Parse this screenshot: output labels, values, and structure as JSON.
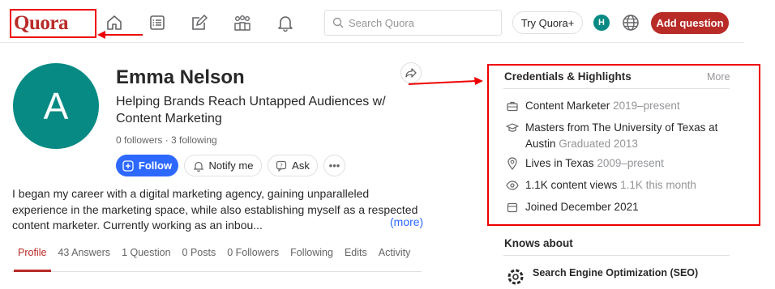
{
  "header": {
    "logo": "Quora",
    "nav_icons": [
      "home-icon",
      "answer-list-icon",
      "write-icon",
      "spaces-icon",
      "notifications-icon"
    ],
    "search_placeholder": "Search Quora",
    "try_label": "Try Quora+",
    "user_initial": "H",
    "add_question_label": "Add question"
  },
  "profile": {
    "initial": "A",
    "name": "Emma Nelson",
    "tagline": "Helping Brands Reach Untapped Audiences w/ Content Marketing",
    "followers_text": "0 followers · 3 following",
    "buttons": {
      "follow": "Follow",
      "notify": "Notify me",
      "ask": "Ask",
      "more": "•••"
    },
    "bio": "I began my career with a digital marketing agency, gaining unparalleled experience in the marketing space, while also establishing myself as a respected content marketer. Currently working as an inbou...",
    "more_link": "(more)",
    "tabs": [
      "Profile",
      "43 Answers",
      "1 Question",
      "0 Posts",
      "0 Followers",
      "Following",
      "Edits",
      "Activity"
    ]
  },
  "credentials": {
    "title": "Credentials & Highlights",
    "more_label": "More",
    "items": [
      {
        "icon": "briefcase-icon",
        "text": "Content Marketer",
        "gray": "2019–present"
      },
      {
        "icon": "graduation-cap-icon",
        "text": "Masters from The University of Texas at Austin",
        "gray": "Graduated 2013"
      },
      {
        "icon": "location-icon",
        "text": "Lives in Texas",
        "gray": "2009–present"
      },
      {
        "icon": "eye-icon",
        "text": "1.1K content views",
        "gray": "1.1K this month"
      },
      {
        "icon": "calendar-icon",
        "text": "Joined December 2021",
        "gray": ""
      }
    ]
  },
  "knows_about": {
    "title": "Knows about",
    "first_topic": "Search Engine Optimization (SEO)"
  },
  "colors": {
    "brand": "#b92b27",
    "primary": "#2e69ff",
    "avatar": "#078a83",
    "annotation": "#ee0000"
  }
}
